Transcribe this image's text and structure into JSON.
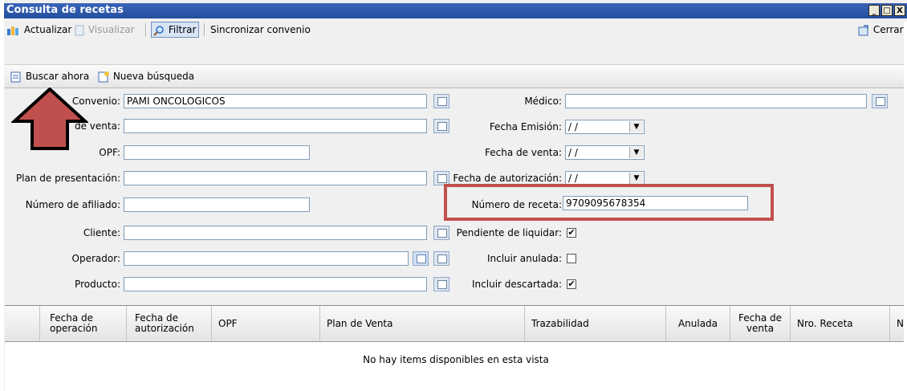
{
  "window": {
    "title": "Consulta de recetas",
    "controls": [
      "_",
      "□",
      "X"
    ]
  },
  "toolbar": {
    "actualizar": "Actualizar",
    "visualizar": "Visualizar",
    "filtrar": "Filtrar",
    "sincronizar": "Sincronizar convenio",
    "cerrar": "Cerrar"
  },
  "search_bar": {
    "buscar": "Buscar ahora",
    "nueva": "Nueva búsqueda"
  },
  "form_left": {
    "convenio_label": "Convenio:",
    "convenio_value": "PAMI ONCOLOGICOS",
    "venta_label": "de venta:",
    "opf_label": "OPF:",
    "plan_label": "Plan de presentación:",
    "afiliado_label": "Número de afiliado:",
    "cliente_label": "Cliente:",
    "operador_label": "Operador:",
    "producto_label": "Producto:"
  },
  "form_right": {
    "medico_label": "Médico:",
    "emision_label": "Fecha Emisión:",
    "emision_value": "/ /",
    "fventa_label": "Fecha de venta:",
    "fventa_value": "/ /",
    "autorizacion_label": "Fecha de autorización:",
    "autorizacion_value": "/ /",
    "receta_label": "Número de receta:",
    "receta_value": "9709095678354",
    "pendiente_label": "Pendiente de liquidar:",
    "pendiente_checked": true,
    "anulada_label": "Incluir anulada:",
    "anulada_checked": false,
    "descartada_label": "Incluir descartada:",
    "descartada_checked": true
  },
  "grid": {
    "columns": [
      {
        "l1": "Fecha de",
        "l2": "operación"
      },
      {
        "l1": "Fecha de",
        "l2": "autorización"
      },
      {
        "l1": "OPF",
        "l2": ""
      },
      {
        "l1": "Plan de Venta",
        "l2": ""
      },
      {
        "l1": "Trazabilidad",
        "l2": ""
      },
      {
        "l1": "Anulada",
        "l2": ""
      },
      {
        "l1": "Fecha de",
        "l2": "venta"
      },
      {
        "l1": "Nro. Receta",
        "l2": ""
      },
      {
        "l1": "N",
        "l2": ""
      }
    ],
    "empty_message": "No hay items disponibles en esta vista"
  },
  "colors": {
    "title_bar": "#2c56a6",
    "highlight_box": "#c0504d",
    "arrow": "#c0504d"
  }
}
